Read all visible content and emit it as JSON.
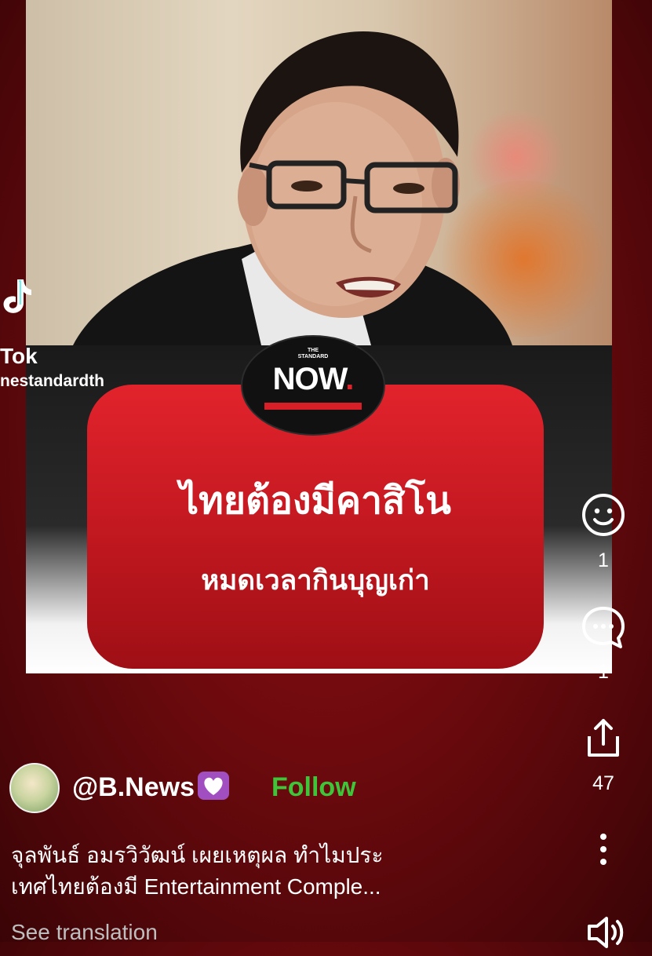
{
  "video": {
    "card_title": "ไทยต้องมีคาสิโน",
    "card_subtitle": "หมดเวลากินบุญเก่า",
    "logo_top_small_1": "THE",
    "logo_top_small_2": "STANDARD",
    "logo_word": "NOW",
    "logo_dot": "."
  },
  "tiktok_watermark": {
    "name": "Tok",
    "handle": "nestandardth"
  },
  "rail": {
    "reaction_count": "1",
    "comment_count": "1",
    "share_count": "47"
  },
  "author": {
    "username": "@B.News",
    "follow_label": "Follow"
  },
  "description": {
    "line1": "จุลพันธ์ อมรวิวัฒน์ เผยเหตุผล ทำไมประ",
    "line2": "เทศไทยต้องมี Entertainment Comple...",
    "see_translation": "See translation"
  },
  "colors": {
    "background": "#6d0a0e",
    "card_red": "#d81f27",
    "follow_green": "#3fc53a",
    "badge_purple": "#a14fc0"
  },
  "icons": [
    "tiktok-icon",
    "emoji-reaction-icon",
    "comment-icon",
    "share-icon",
    "more-icon",
    "volume-icon",
    "heart-badge-icon"
  ]
}
